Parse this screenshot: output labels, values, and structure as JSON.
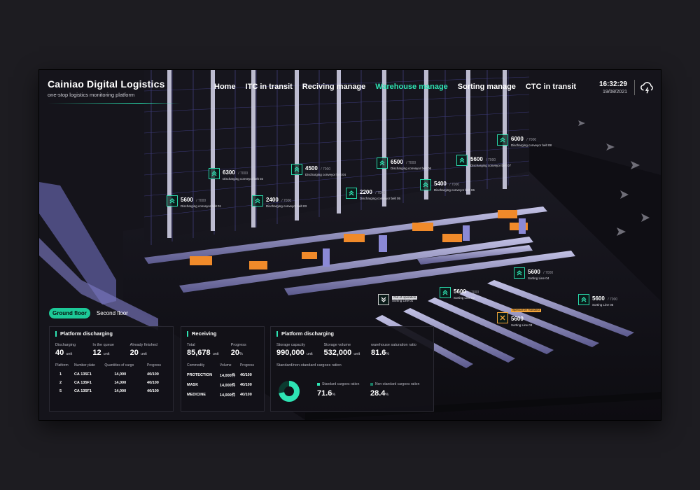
{
  "header": {
    "title": "Cainiao Digital Logistics",
    "subtitle": "one-stop logistics monitoring platform",
    "time": "16:32:29",
    "date": "19/08/2021"
  },
  "nav": {
    "items": [
      {
        "label": "Home"
      },
      {
        "label": "ITC in transit"
      },
      {
        "label": "Reciving manage"
      },
      {
        "label": "Warehouse manage",
        "active": true
      },
      {
        "label": "Sorting manage"
      },
      {
        "label": "CTC in transit"
      }
    ]
  },
  "floors": {
    "ground": "Ground floor",
    "second": "Second floor"
  },
  "callouts": [
    {
      "value": "5600",
      "cap": "/ 7000",
      "label": "Discharging conveyor belt 01"
    },
    {
      "value": "6300",
      "cap": "/ 7000",
      "label": "Discharging conveyor belt 02"
    },
    {
      "value": "2400",
      "cap": "/ 7000",
      "label": "Discharging conveyor belt 03"
    },
    {
      "value": "4500",
      "cap": "/ 7000",
      "label": "Discharging conveyor belt 04"
    },
    {
      "value": "2200",
      "cap": "/ 7000",
      "label": "Discharging conveyor belt 05"
    },
    {
      "value": "6500",
      "cap": "/ 7000",
      "label": "Discharging conveyor belt 06"
    },
    {
      "value": "5400",
      "cap": "/ 7000",
      "label": "Discharging conveyor belt 06"
    },
    {
      "value": "5600",
      "cap": "/ 7000",
      "label": "Discharging conveyor belt 07"
    },
    {
      "value": "6000",
      "cap": "/ 7000",
      "label": "Discharging conveyor belt 08"
    },
    {
      "value": "5600",
      "cap": "/ 7000",
      "label": "Sorting Line 04"
    },
    {
      "value": "5600",
      "cap": "/ 7000",
      "label": "Sorting Line 02"
    },
    {
      "value": "5600",
      "cap": "/ 7000",
      "label": "Sorting Line 05"
    },
    {
      "value": "5600",
      "cap": "/ 7000",
      "label": "Sorting Line 03",
      "tag": "Special be Handled"
    },
    {
      "value": "",
      "cap": "",
      "label": "Sorting Line 01",
      "tag": "Out of operation"
    }
  ],
  "panel_left": {
    "title": "Platform discharging",
    "stats": [
      {
        "cap": "Discharging",
        "value": "40",
        "unit": "unit"
      },
      {
        "cap": "In the queue",
        "value": "12",
        "unit": "unit"
      },
      {
        "cap": "Already finished",
        "value": "20",
        "unit": "unit"
      }
    ],
    "columns": [
      "Platform",
      "Number plate",
      "Quantities of cargo",
      "Progress"
    ],
    "rows": [
      [
        "1",
        "CA 135F1",
        "14,000",
        "40/100"
      ],
      [
        "2",
        "CA 135F1",
        "14,000",
        "40/100"
      ],
      [
        "5",
        "CA 135F1",
        "14,000",
        "40/100"
      ]
    ]
  },
  "panel_mid": {
    "title": "Receiving",
    "stats": [
      {
        "cap": "Total",
        "value": "85,678",
        "unit": "unit"
      },
      {
        "cap": "Progress",
        "value": "20",
        "unit": "%"
      }
    ],
    "columns": [
      "Commodity",
      "Volume",
      "Progress"
    ],
    "rows": [
      [
        "PROTECTION",
        "14,000件",
        "40/100"
      ],
      [
        "MASK",
        "14,000件",
        "40/100"
      ],
      [
        "MEDICINE",
        "14,000件",
        "40/100"
      ]
    ]
  },
  "panel_right": {
    "title": "Platform discharging",
    "stats": [
      {
        "cap": "Storage capacity",
        "value": "990,000",
        "unit": "unit"
      },
      {
        "cap": "Storage volume",
        "value": "532,000",
        "unit": "unit"
      },
      {
        "cap": "warehouse saturation ratio",
        "value": "81.6",
        "unit": "%"
      }
    ],
    "ratio_title": "Standard/non-standard cargoes ration",
    "standard_label": "Standard cargoes ration",
    "standard_value": "71.6",
    "nonstandard_label": "Non-standard cargoes ration",
    "nonstandard_value": "28.4",
    "unit": "%",
    "standard_fraction": 0.716
  },
  "colors": {
    "accent": "#2ee3b3",
    "warning": "#f2a43a",
    "panel": "#121118",
    "rack": "#6c69c4"
  }
}
